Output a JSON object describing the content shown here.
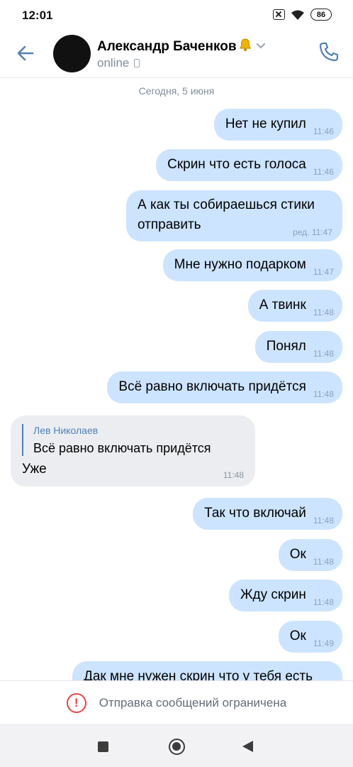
{
  "status_bar": {
    "time": "12:01",
    "battery": "86",
    "icons": [
      "sim-off-icon",
      "wifi-icon",
      "battery-icon"
    ]
  },
  "header": {
    "contact_name": "Александр Баченков",
    "status": "online",
    "icons": [
      "back-arrow-icon",
      "bell-icon",
      "chevron-down-icon",
      "mobile-device-icon",
      "phone-call-icon"
    ],
    "accent_color": "#5181b8"
  },
  "chat": {
    "date_separator": "Сегодня, 5 июня",
    "messages": [
      {
        "direction": "out",
        "text": "Нет не купил",
        "time": "11:46",
        "edited": ""
      },
      {
        "direction": "out",
        "text": "Скрин что есть голоса",
        "time": "11:46",
        "edited": ""
      },
      {
        "direction": "out",
        "text_line1": "А как ты собираешься стики",
        "text_line2": "отправить",
        "time": "ред. 11:47"
      },
      {
        "direction": "out",
        "text": "Мне нужно подарком",
        "time": "11:47",
        "edited": ""
      },
      {
        "direction": "out",
        "text": "А твинк",
        "time": "11:48",
        "edited": ""
      },
      {
        "direction": "out",
        "text": "Понял",
        "time": "11:48",
        "edited": ""
      },
      {
        "direction": "out",
        "text": "Всё равно включать придётся",
        "time": "11:48",
        "edited": ""
      },
      {
        "direction": "in",
        "reply_author": "Лев Николаев",
        "reply_text": "Всё равно включать придётся",
        "text": "Уже",
        "time": "11:48"
      },
      {
        "direction": "out",
        "text": "Так что включай",
        "time": "11:48",
        "edited": ""
      },
      {
        "direction": "out",
        "text": "Ок",
        "time": "11:48",
        "edited": ""
      },
      {
        "direction": "out",
        "text": "Жду скрин",
        "time": "11:48",
        "edited": ""
      },
      {
        "direction": "out",
        "text": "Ок",
        "time": "11:49",
        "edited": ""
      },
      {
        "direction": "out",
        "text": "Дак мне нужен скрин что у тебя есть",
        "time": "",
        "edited": ""
      }
    ],
    "colors": {
      "outgoing_bubble": "#cce4ff",
      "incoming_bubble": "#ebedf0"
    }
  },
  "restriction": {
    "icon": "warning-circle-icon",
    "text": "Отправка сообщений ограничена",
    "color": "#e64646"
  },
  "nav_bar": {
    "icons": [
      "recents-square-icon",
      "home-circle-icon",
      "back-triangle-icon"
    ]
  }
}
